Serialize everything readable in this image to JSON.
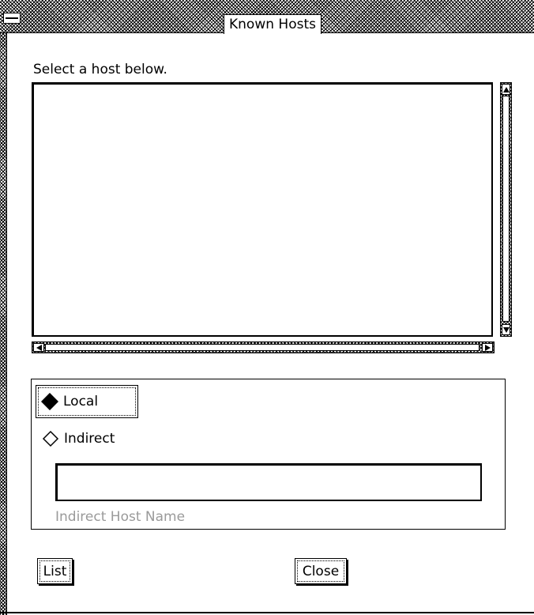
{
  "window": {
    "title": "Known Hosts"
  },
  "host_list": {
    "prompt": "Select a host below.",
    "items": []
  },
  "host_type": {
    "options": [
      {
        "label": "Local",
        "selected": true
      },
      {
        "label": "Indirect",
        "selected": false
      }
    ]
  },
  "indirect_host": {
    "value": "",
    "caption": "Indirect Host Name"
  },
  "buttons": {
    "list_label": "List",
    "close_label": "Close"
  },
  "icons": {
    "window_menu": "window-menu-icon",
    "scroll_up": "up-arrow-icon",
    "scroll_down": "down-arrow-icon",
    "scroll_left": "left-arrow-icon",
    "scroll_right": "right-arrow-icon",
    "radio_selected": "filled-diamond-icon",
    "radio_unselected": "empty-diamond-icon"
  },
  "colors": {
    "background": "#ffffff",
    "foreground": "#000000",
    "disabled_text": "#9a9a9a"
  }
}
